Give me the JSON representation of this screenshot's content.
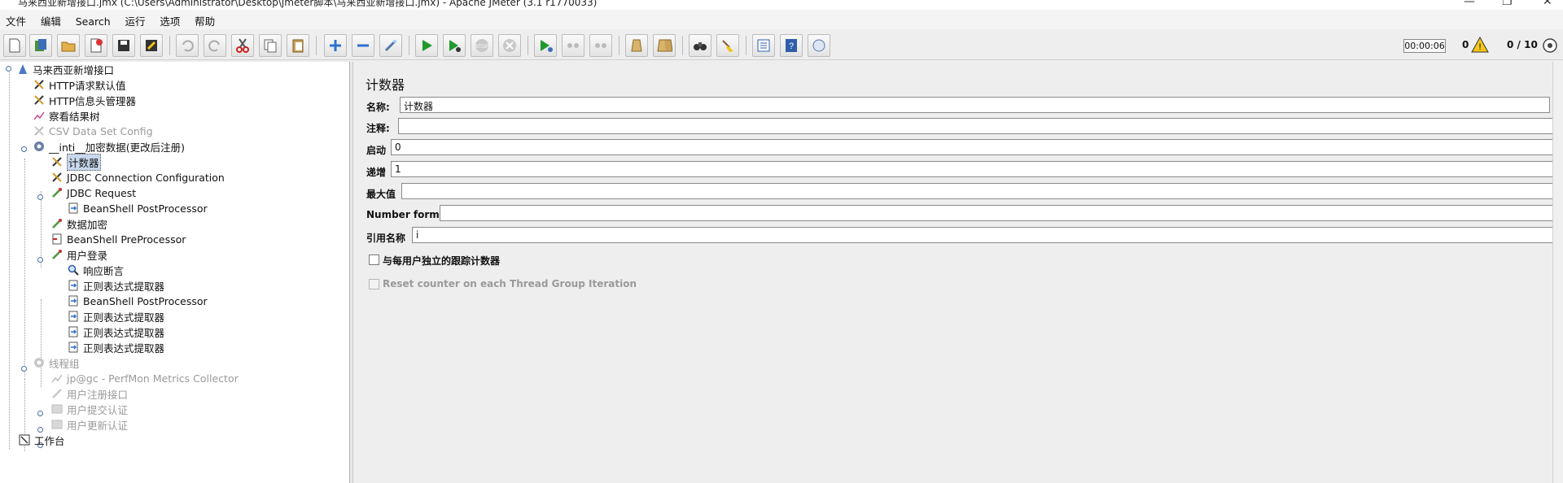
{
  "window": {
    "title": "马来西亚新增接口.jmx (C:\\Users\\Administrator\\Desktop\\jmeter脚本\\马来西亚新增接口.jmx) - Apache JMeter (3.1 r1770033)"
  },
  "menu": [
    "文件",
    "编辑",
    "Search",
    "运行",
    "选项",
    "帮助"
  ],
  "status": {
    "elapsed": "00:00:06",
    "errors": "0",
    "threads": "0 / 10"
  },
  "tree": {
    "items": [
      {
        "label": "马来西亚新增接口",
        "icon": "test-plan-icon"
      },
      {
        "label": "HTTP请求默认值",
        "icon": "config-tools-icon"
      },
      {
        "label": "HTTP信息头管理器",
        "icon": "config-tools-icon"
      },
      {
        "label": "察看结果树",
        "icon": "listener-chart-icon"
      },
      {
        "label": "CSV Data Set Config",
        "icon": "config-tools-icon"
      },
      {
        "label": "__inti__加密数据(更改后注册)",
        "icon": "thread-group-gear-icon"
      },
      {
        "label": "计数器",
        "icon": "config-tools-icon"
      },
      {
        "label": "JDBC Connection Configuration",
        "icon": "config-tools-icon"
      },
      {
        "label": "JDBC Request",
        "icon": "sampler-pipette-icon"
      },
      {
        "label": "BeanShell PostProcessor",
        "icon": "post-processor-icon"
      },
      {
        "label": "数据加密",
        "icon": "sampler-pipette-icon"
      },
      {
        "label": "BeanShell PreProcessor",
        "icon": "pre-processor-icon"
      },
      {
        "label": "用户登录",
        "icon": "sampler-pipette-icon"
      },
      {
        "label": "响应断言",
        "icon": "assertion-magnifier-icon"
      },
      {
        "label": "正则表达式提取器",
        "icon": "post-processor-icon"
      },
      {
        "label": "BeanShell PostProcessor",
        "icon": "post-processor-icon"
      },
      {
        "label": "正则表达式提取器",
        "icon": "post-processor-icon"
      },
      {
        "label": "正则表达式提取器",
        "icon": "post-processor-icon"
      },
      {
        "label": "正则表达式提取器",
        "icon": "post-processor-icon"
      },
      {
        "label": "线程组",
        "icon": "thread-group-gear-icon"
      },
      {
        "label": "jp@gc - PerfMon Metrics Collector",
        "icon": "listener-chart-icon"
      },
      {
        "label": "用户注册接口",
        "icon": "sampler-pipette-icon"
      },
      {
        "label": "用户提交认证",
        "icon": "simple-controller-icon"
      },
      {
        "label": "用户更新认证",
        "icon": "simple-controller-icon"
      },
      {
        "label": "工作台",
        "icon": "workbench-icon"
      }
    ]
  },
  "editor": {
    "title": "计数器",
    "fields": {
      "name_label": "名称:",
      "name_value": "计数器",
      "comment_label": "注释:",
      "comment_value": "",
      "start_label": "启动",
      "start_value": "0",
      "increment_label": "递增",
      "increment_value": "1",
      "max_label": "最大值",
      "max_value": "",
      "format_label": "Number format",
      "format_value": "",
      "ref_label": "引用名称",
      "ref_value": "i"
    },
    "checkbox_per_user": "与每用户独立的跟踪计数器",
    "checkbox_reset": "Reset counter on each Thread Group Iteration"
  },
  "colors": {
    "selection": "#c8d8ec",
    "disabled_text": "#9a9a9a",
    "accent_blue": "#2f6fd0"
  }
}
